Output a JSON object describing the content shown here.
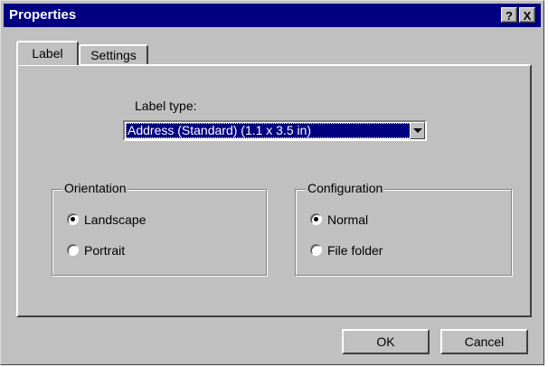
{
  "window": {
    "title": "Properties",
    "help_glyph": "?",
    "close_glyph": "X"
  },
  "tabs": [
    {
      "label": "Label",
      "active": true
    },
    {
      "label": "Settings",
      "active": false
    }
  ],
  "label_type": {
    "caption": "Label type:",
    "selected": "Address (Standard)  (1.1 x 3.5 in)"
  },
  "orientation": {
    "legend": "Orientation",
    "options": [
      {
        "label": "Landscape",
        "checked": true
      },
      {
        "label": "Portrait",
        "checked": false
      }
    ]
  },
  "configuration": {
    "legend": "Configuration",
    "options": [
      {
        "label": "Normal",
        "checked": true
      },
      {
        "label": "File folder",
        "checked": false
      }
    ]
  },
  "buttons": {
    "ok": "OK",
    "cancel": "Cancel"
  },
  "colors": {
    "face": "#c0c0c0",
    "titlebar": "#000080",
    "selection": "#000080"
  }
}
